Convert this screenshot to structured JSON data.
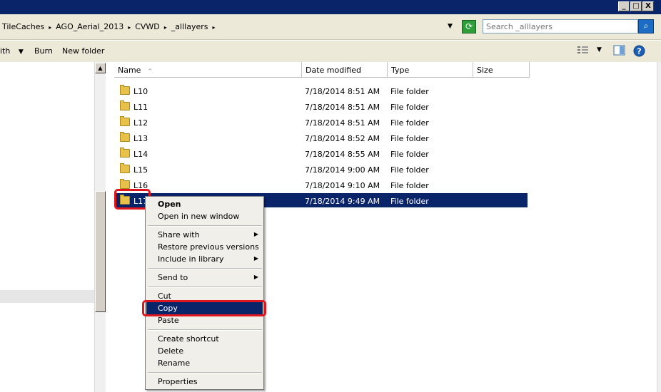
{
  "window": {
    "minimize": "_",
    "maximize": "□",
    "close": "X"
  },
  "address": {
    "crumbs": [
      "TileCaches",
      "AGO_Aerial_2013",
      "CVWD",
      "_alllayers"
    ],
    "separator": "▸",
    "dropdown_arrow": "▼",
    "search_placeholder": "Search _alllayers",
    "search_icon": "magnifier-icon",
    "refresh_icon": "refresh-arrows-icon"
  },
  "toolbar": {
    "share_partial": "ith",
    "share_arrow": "▼",
    "burn": "Burn",
    "new_folder": "New folder",
    "view_icon": "view-list-icon",
    "view_arrow": "▼",
    "preview_icon": "preview-pane-icon",
    "help_icon": "help-icon",
    "help_glyph": "?"
  },
  "columns": {
    "name": "Name",
    "sort_indicator": "^",
    "date_modified": "Date modified",
    "type": "Type",
    "size": "Size"
  },
  "rows": [
    {
      "name": "L10",
      "date": "7/18/2014 8:51 AM",
      "type": "File folder"
    },
    {
      "name": "L11",
      "date": "7/18/2014 8:51 AM",
      "type": "File folder"
    },
    {
      "name": "L12",
      "date": "7/18/2014 8:51 AM",
      "type": "File folder"
    },
    {
      "name": "L13",
      "date": "7/18/2014 8:52 AM",
      "type": "File folder"
    },
    {
      "name": "L14",
      "date": "7/18/2014 8:55 AM",
      "type": "File folder"
    },
    {
      "name": "L15",
      "date": "7/18/2014 9:00 AM",
      "type": "File folder"
    },
    {
      "name": "L16",
      "date": "7/18/2014 9:10 AM",
      "type": "File folder"
    },
    {
      "name": "L17",
      "date": "7/18/2014 9:49 AM",
      "type": "File folder"
    }
  ],
  "context_menu": {
    "open": "Open",
    "open_new_window": "Open in new window",
    "share_with": "Share with",
    "restore_previous": "Restore previous versions",
    "include_library": "Include in library",
    "send_to": "Send to",
    "cut": "Cut",
    "copy": "Copy",
    "paste": "Paste",
    "create_shortcut": "Create shortcut",
    "delete": "Delete",
    "rename": "Rename",
    "properties": "Properties",
    "submenu_arrow": "▶"
  },
  "colors": {
    "selection": "#0a246a",
    "annotation_red": "#e0161e",
    "titlebar": "#0a246a",
    "chrome": "#ece9d8"
  }
}
